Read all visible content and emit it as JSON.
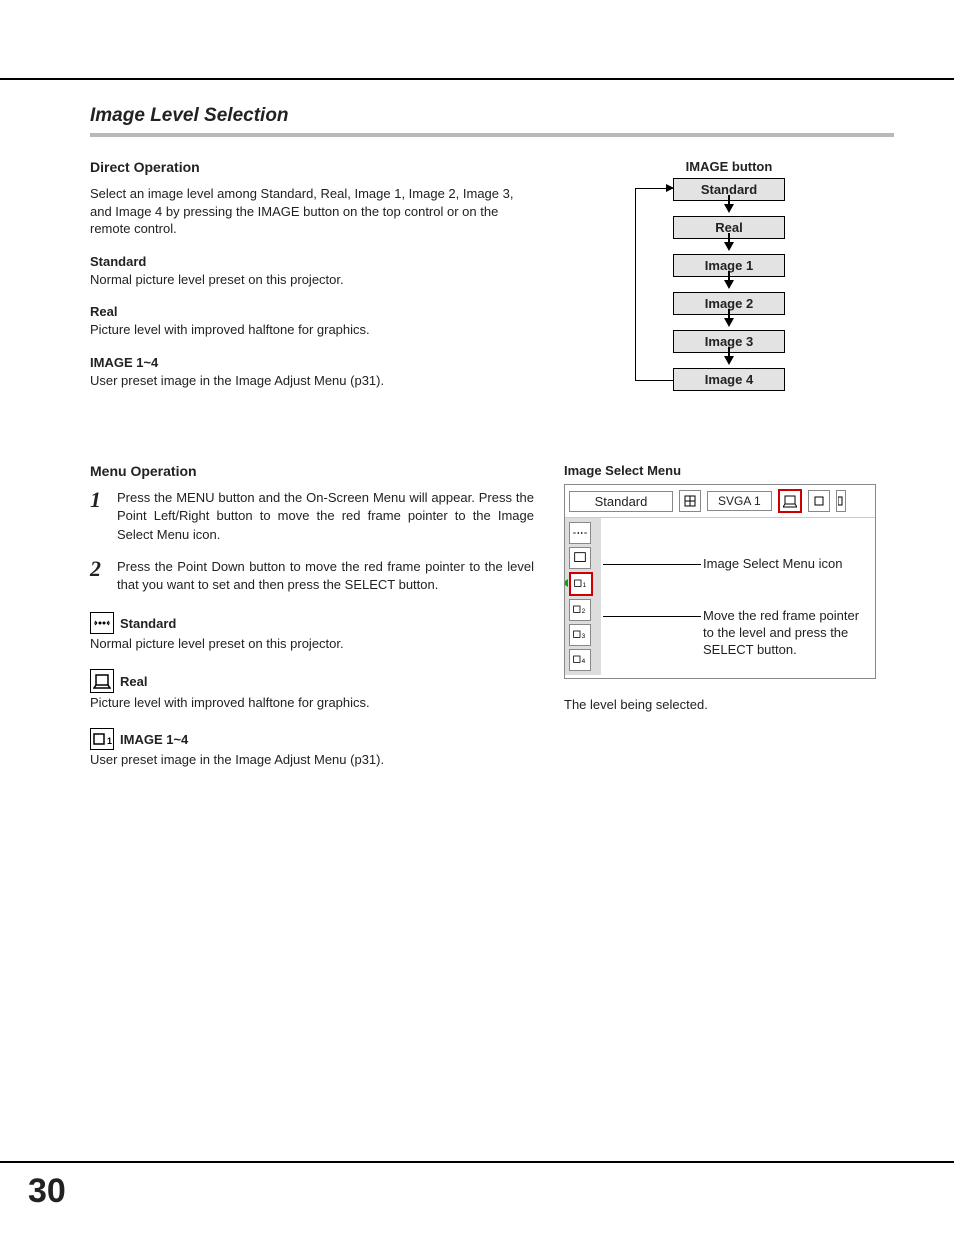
{
  "section_title": "Image Level Selection",
  "direct": {
    "heading": "Direct Operation",
    "intro": "Select an image level among Standard, Real, Image 1, Image 2, Image 3, and Image 4 by pressing the IMAGE button on the top control or on the remote control.",
    "defs": [
      {
        "title": "Standard",
        "body": "Normal picture level preset on this projector."
      },
      {
        "title": "Real",
        "body": "Picture level with improved halftone for graphics."
      },
      {
        "title": "IMAGE 1~4",
        "body": "User preset image in the Image Adjust Menu (p31)."
      }
    ]
  },
  "flow": {
    "label": "IMAGE button",
    "items": [
      "Standard",
      "Real",
      "Image 1",
      "Image 2",
      "Image 3",
      "Image 4"
    ]
  },
  "menu": {
    "heading": "Menu Operation",
    "steps": [
      "Press the MENU button and the On-Screen Menu will appear. Press the Point Left/Right button to move the red frame pointer to the Image Select Menu icon.",
      "Press the Point Down button to move the red frame pointer to the level that you want to set and then press the SELECT button."
    ],
    "icon_defs": [
      {
        "title": "Standard",
        "body": "Normal picture level preset on this projector."
      },
      {
        "title": "Real",
        "body": "Picture level with improved halftone for graphics."
      },
      {
        "title": "IMAGE 1~4",
        "body": "User preset image in the Image Adjust Menu (p31)."
      }
    ]
  },
  "mock": {
    "label": "Image Select Menu",
    "status": "Standard",
    "svga": "SVGA 1",
    "callout1": "Image Select Menu icon",
    "callout2": "Move the red frame pointer to the level and press the SELECT button.",
    "caption": "The level being selected."
  },
  "page_number": "30"
}
